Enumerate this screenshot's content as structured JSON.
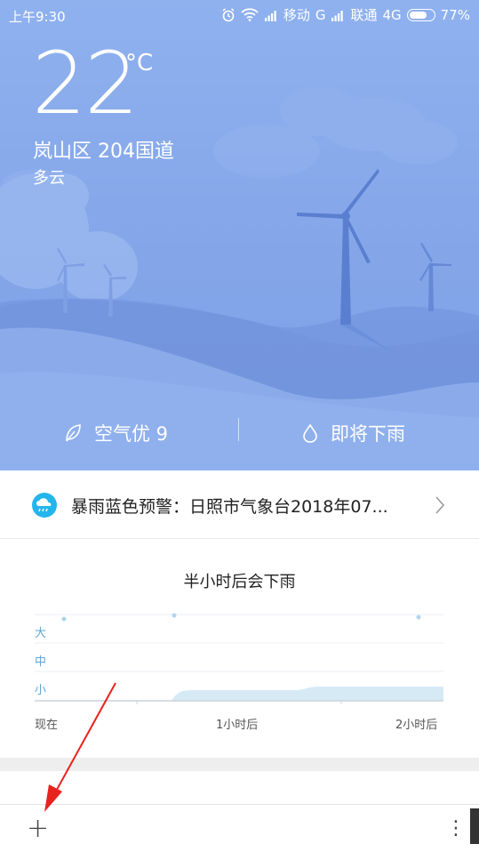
{
  "status_bar": {
    "time": "上午9:30",
    "carrier1": "移动",
    "carrier1_net": "G",
    "carrier2": "联通",
    "carrier2_net": "4G",
    "battery": "77%",
    "icons": [
      "alarm-icon",
      "wifi-icon",
      "signal-icon",
      "battery-icon"
    ]
  },
  "weather": {
    "temperature": "22",
    "unit": "°C",
    "location": "岚山区  204国道",
    "condition": "多云"
  },
  "metrics": {
    "air": "空气优 9",
    "rain": "即将下雨"
  },
  "alert": {
    "text": "暴雨蓝色预警：日照市气象台2018年07..."
  },
  "rain_forecast": {
    "title": "半小时后会下雨",
    "levels": [
      "大",
      "中",
      "小"
    ],
    "time_labels": [
      "现在",
      "1小时后",
      "2小时后"
    ]
  },
  "bottom_bar": {
    "add": "+",
    "more": "⋮"
  },
  "colors": {
    "sky_top": "#8fb1ee",
    "hill": "#6f93dd",
    "alert_icon": "#23b5ec",
    "rain_fill": "#d6eaf6",
    "annotation_arrow": "#e8231f"
  }
}
